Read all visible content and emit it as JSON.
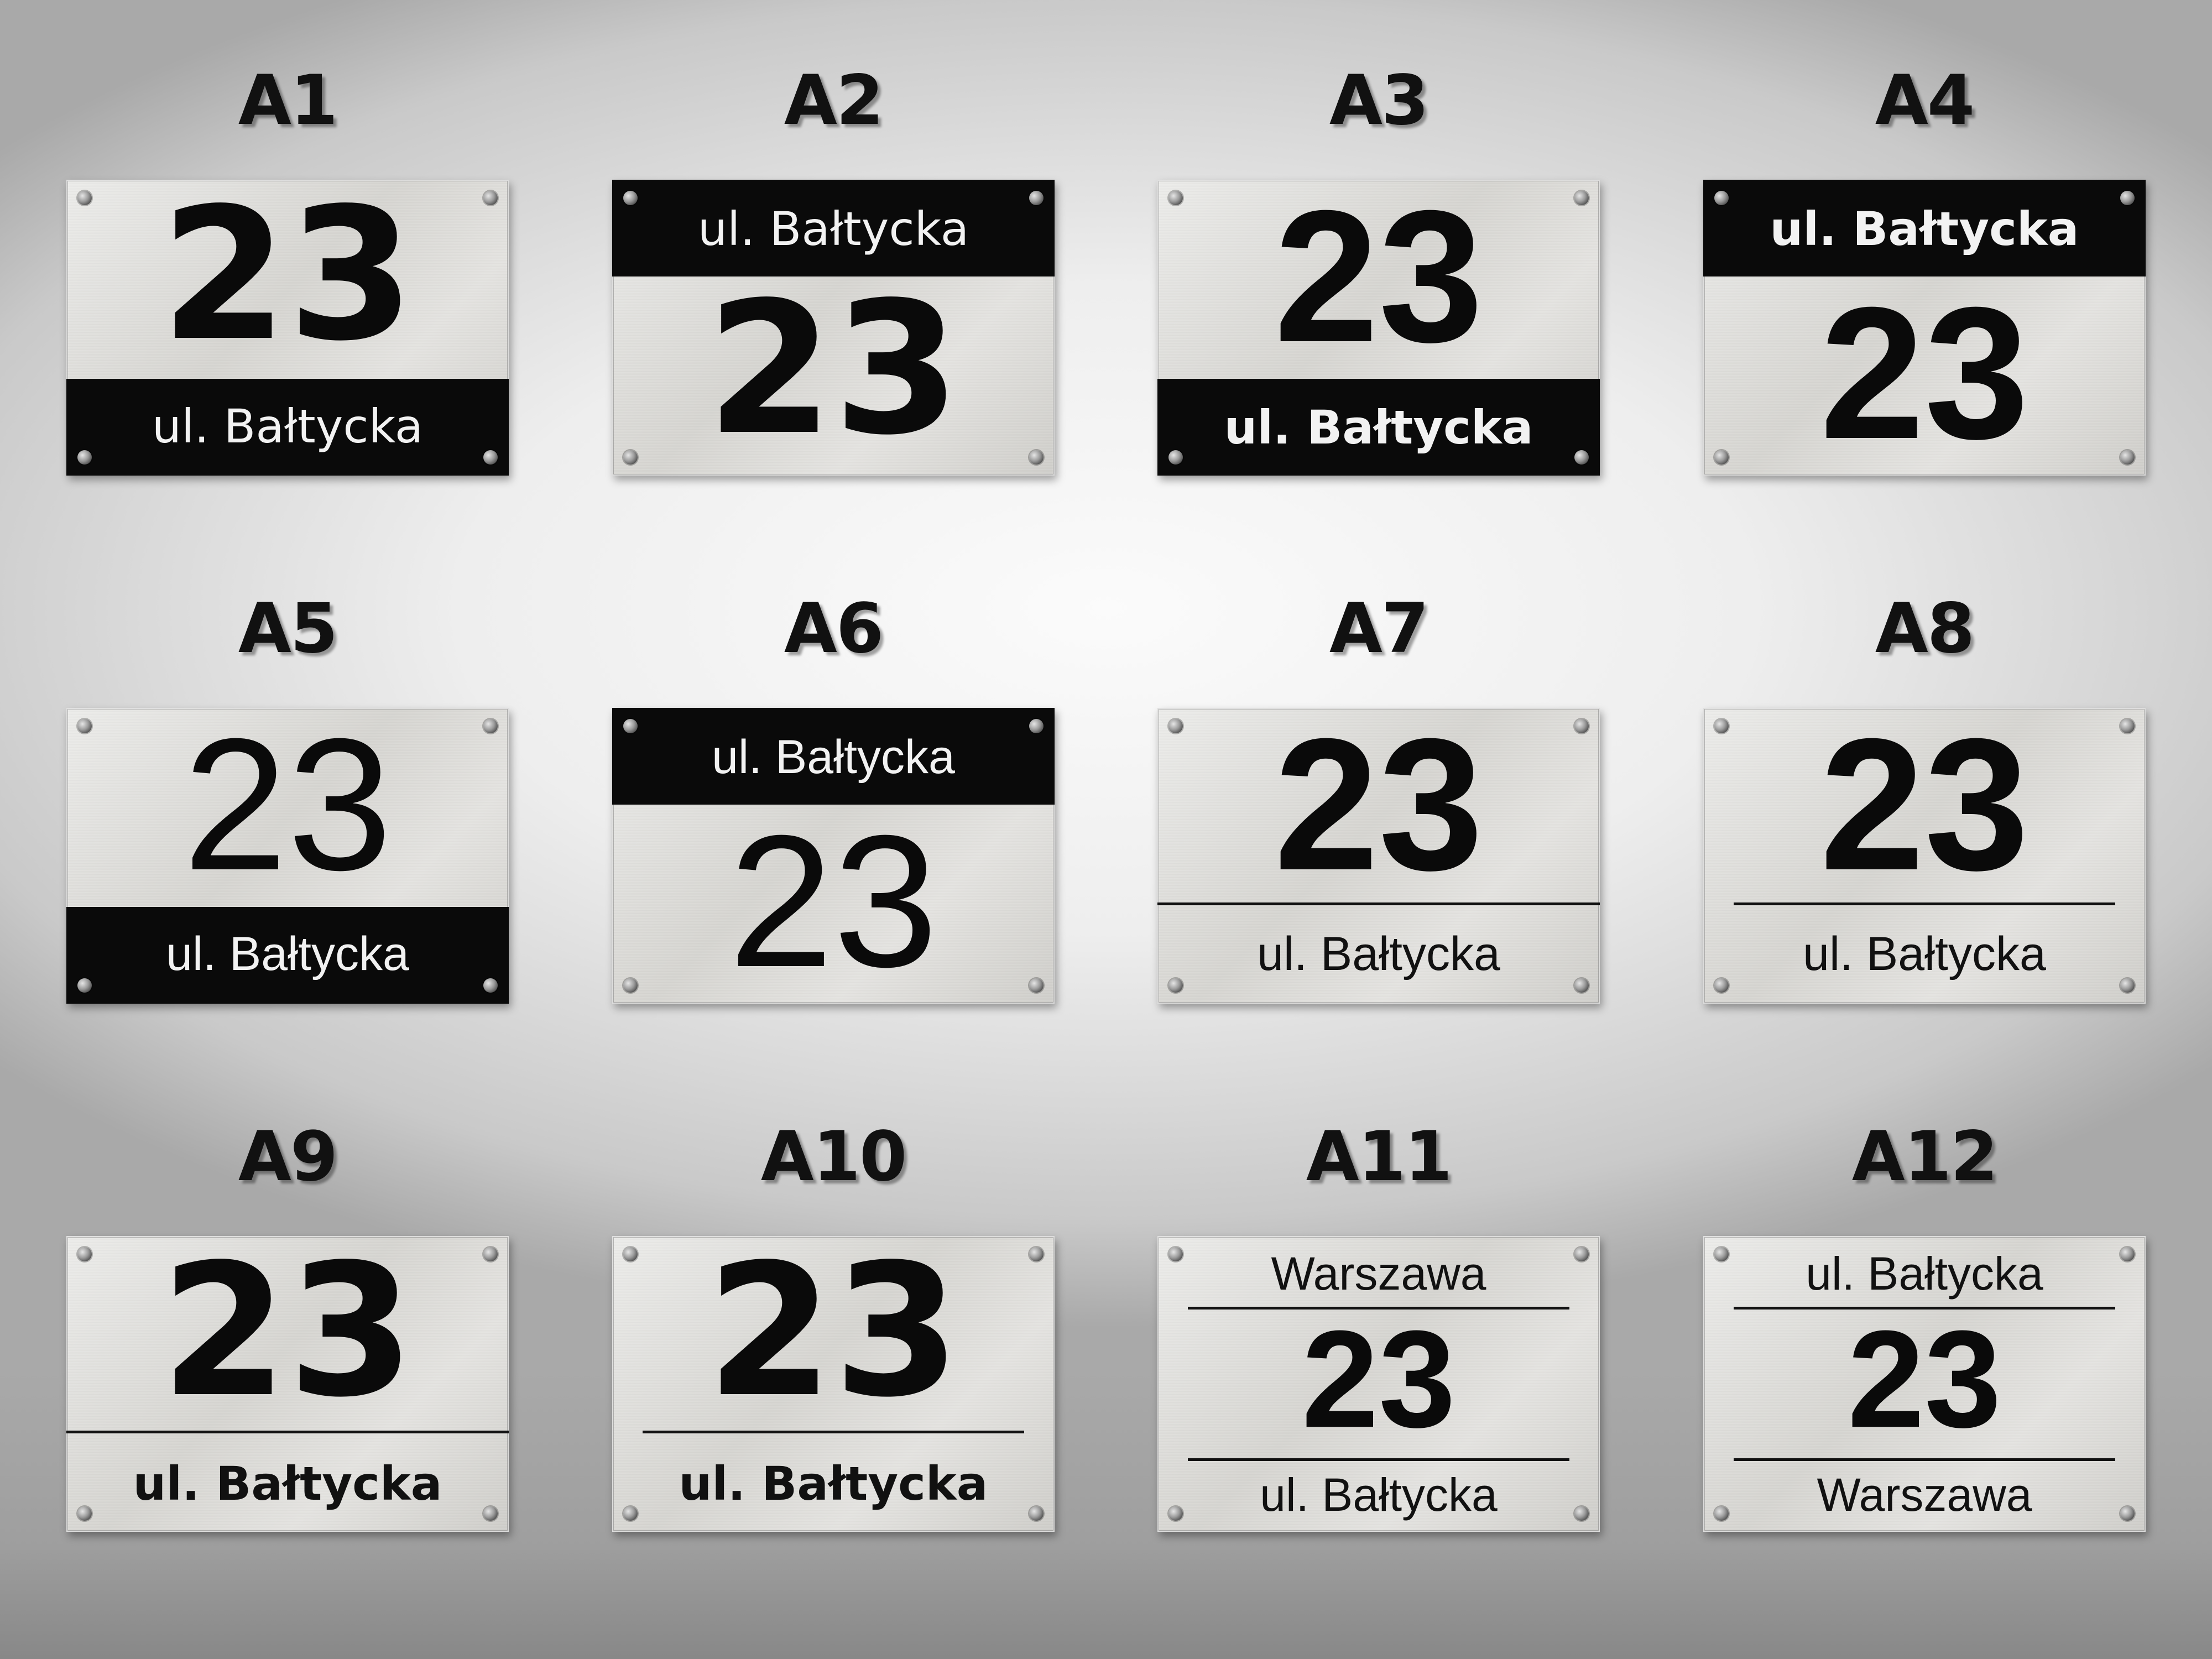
{
  "plates": [
    {
      "code": "A1",
      "number": "23",
      "line1": "ul. Bałtycka"
    },
    {
      "code": "A2",
      "number": "23",
      "line1": "ul. Bałtycka"
    },
    {
      "code": "A3",
      "number": "23",
      "line1": "ul. Bałtycka"
    },
    {
      "code": "A4",
      "number": "23",
      "line1": "ul. Bałtycka"
    },
    {
      "code": "A5",
      "number": "23",
      "line1": "ul. Bałtycka"
    },
    {
      "code": "A6",
      "number": "23",
      "line1": "ul. Bałtycka"
    },
    {
      "code": "A7",
      "number": "23",
      "line1": "ul. Bałtycka"
    },
    {
      "code": "A8",
      "number": "23",
      "line1": "ul. Bałtycka"
    },
    {
      "code": "A9",
      "number": "23",
      "line1": "ul. Bałtycka"
    },
    {
      "code": "A10",
      "number": "23",
      "line1": "ul. Bałtycka"
    },
    {
      "code": "A11",
      "number": "23",
      "top_line": "Warszawa",
      "bottom_line": "ul. Bałtycka"
    },
    {
      "code": "A12",
      "number": "23",
      "top_line": "ul. Bałtycka",
      "bottom_line": "Warszawa"
    }
  ]
}
